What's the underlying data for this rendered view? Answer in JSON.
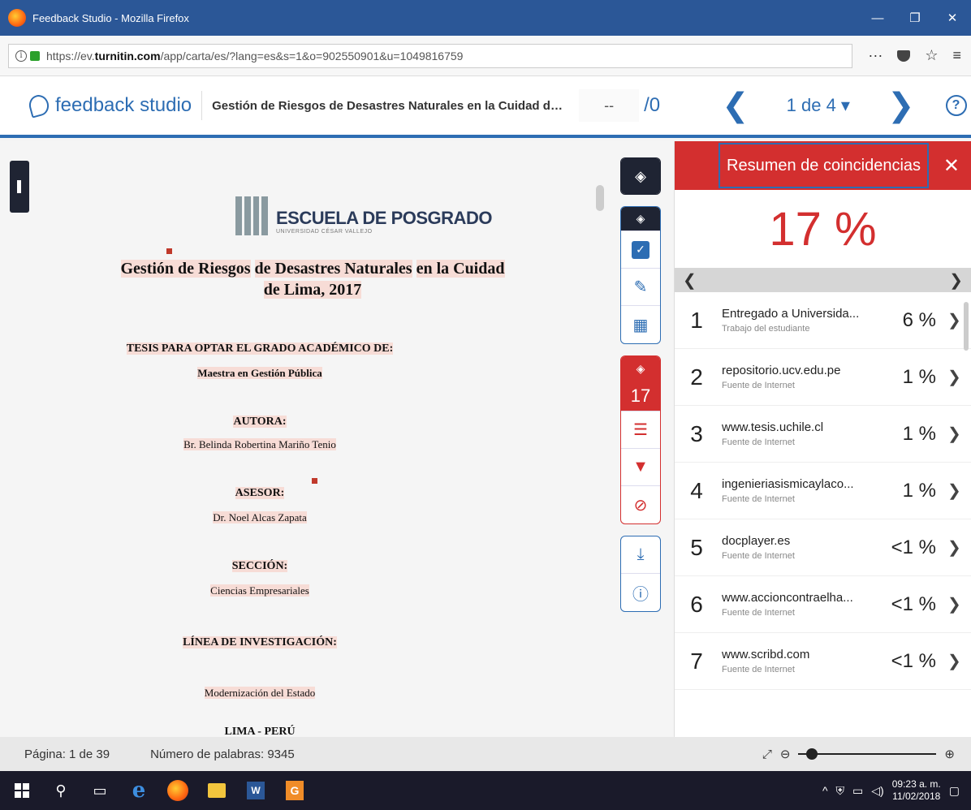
{
  "window": {
    "title": "Feedback Studio - Mozilla Firefox",
    "minimize": "—",
    "restore": "❐",
    "close": "✕"
  },
  "urlbar": {
    "url_pre": "https://ev.",
    "url_domain": "turnitin.com",
    "url_post": "/app/carta/es/?lang=es&s=1&o=902550901&u=1049816759",
    "more": "···",
    "star": "☆",
    "menu": "≡"
  },
  "header": {
    "logo": "feedback studio",
    "doc_title": "Gestión de Riesgos de Desastres Naturales en la Cuidad de Li...",
    "grade": "--",
    "grade_total": "/0",
    "prev": "❮",
    "next": "❯",
    "page_select": "1 de 4 ▾",
    "help": "?"
  },
  "document": {
    "school": "ESCUELA DE POSGRADO",
    "university": "UNIVERSIDAD CÉSAR VALLEJO",
    "title_line1_a": "Gestión de ",
    "title_line1_b": "Riesgos",
    "title_line1_c": " ",
    "title_line1_d": "de Desastres Naturales",
    "title_line1_e": " ",
    "title_line1_f": "en la Cuidad",
    "title_line2": "de Lima, 2017",
    "degree": "TESIS PARA OPTAR EL GRADO ACADÉMICO DE:",
    "degree_name": "Maestra en Gestión Pública",
    "author_label": "AUTORA:",
    "author": "Br. Belinda Robertina Mariño Tenio",
    "advisor_label": "ASESOR:",
    "advisor": "Dr. Noel Alcas Zapata",
    "section_label": "SECCIÓN:",
    "section": "Ciencias Empresariales",
    "line_label": "LÍNEA DE INVESTIGACIÓN:",
    "line": "Modernización del Estado",
    "place": "LIMA - PERÚ"
  },
  "toolbar": {
    "similarity_count": "17"
  },
  "panel": {
    "title": "Resumen de coincidencias",
    "close": "✕",
    "total": "17 %",
    "prev": "❮",
    "next": "❯",
    "matches": [
      {
        "num": "1",
        "name": "Entregado a Universida...",
        "type": "Trabajo del estudiante",
        "pct": "6 %"
      },
      {
        "num": "2",
        "name": "repositorio.ucv.edu.pe",
        "type": "Fuente de Internet",
        "pct": "1 %"
      },
      {
        "num": "3",
        "name": "www.tesis.uchile.cl",
        "type": "Fuente de Internet",
        "pct": "1 %"
      },
      {
        "num": "4",
        "name": "ingenieriasismicaylaco...",
        "type": "Fuente de Internet",
        "pct": "1 %"
      },
      {
        "num": "5",
        "name": "docplayer.es",
        "type": "Fuente de Internet",
        "pct": "<1 %"
      },
      {
        "num": "6",
        "name": "www.accioncontraelha...",
        "type": "Fuente de Internet",
        "pct": "<1 %"
      },
      {
        "num": "7",
        "name": "www.scribd.com",
        "type": "Fuente de Internet",
        "pct": "<1 %"
      }
    ]
  },
  "status": {
    "page": "Página: 1 de 39",
    "words": "Número de palabras: 9345"
  },
  "taskbar": {
    "time": "09:23 a. m.",
    "date": "11/02/2018"
  }
}
